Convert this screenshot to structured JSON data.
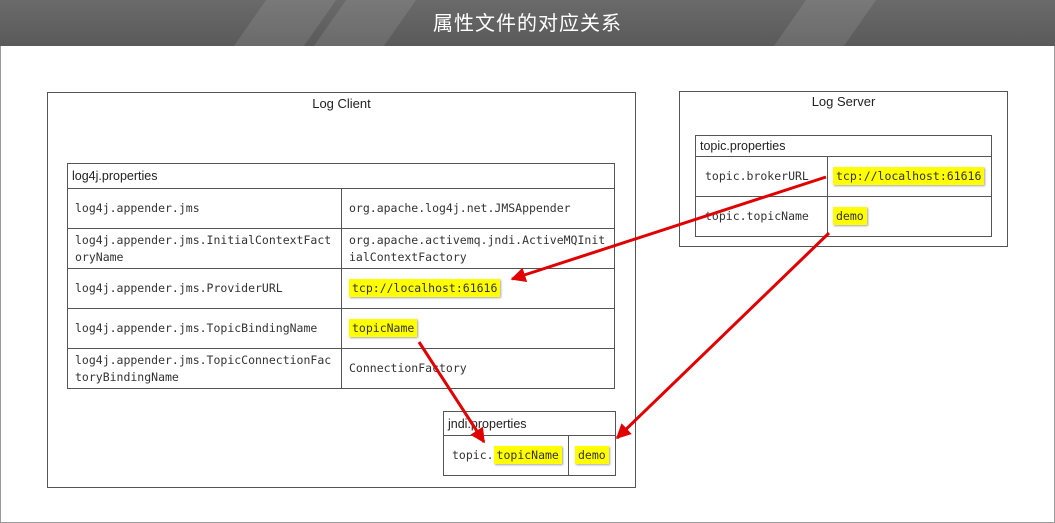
{
  "header": {
    "title": "属性文件的对应关系"
  },
  "log_client": {
    "title": "Log Client",
    "log4j_table": {
      "title": "log4j.properties",
      "rows": [
        {
          "key": "log4j.appender.jms",
          "value": "org.apache.log4j.net.JMSAppender"
        },
        {
          "key": "log4j.appender.jms.InitialContextFact oryName",
          "value": "org.apache.activemq.jndi.ActiveMQInit ialContextFactory"
        },
        {
          "key": "log4j.appender.jms.ProviderURL",
          "value": "tcp://localhost:61616"
        },
        {
          "key": "log4j.appender.jms.TopicBindingName",
          "value": "topicName"
        },
        {
          "key": "log4j.appender.jms.TopicConnectionFac toryBindingName",
          "value": "ConnectionFactory"
        }
      ]
    },
    "jndi_table": {
      "title": "jndi.properties",
      "key_prefix": "topic.",
      "key_name": "topicName",
      "value": "demo"
    }
  },
  "log_server": {
    "title": "Log Server",
    "topic_table": {
      "title": "topic.properties",
      "rows": [
        {
          "key": "topic.brokerURL",
          "value": "tcp://localhost:61616"
        },
        {
          "key": "topic.topicName",
          "value": "demo"
        }
      ]
    }
  },
  "colors": {
    "arrow": "#e00000",
    "highlight": "#ffff00",
    "header_bg": "#5f5f5f"
  }
}
